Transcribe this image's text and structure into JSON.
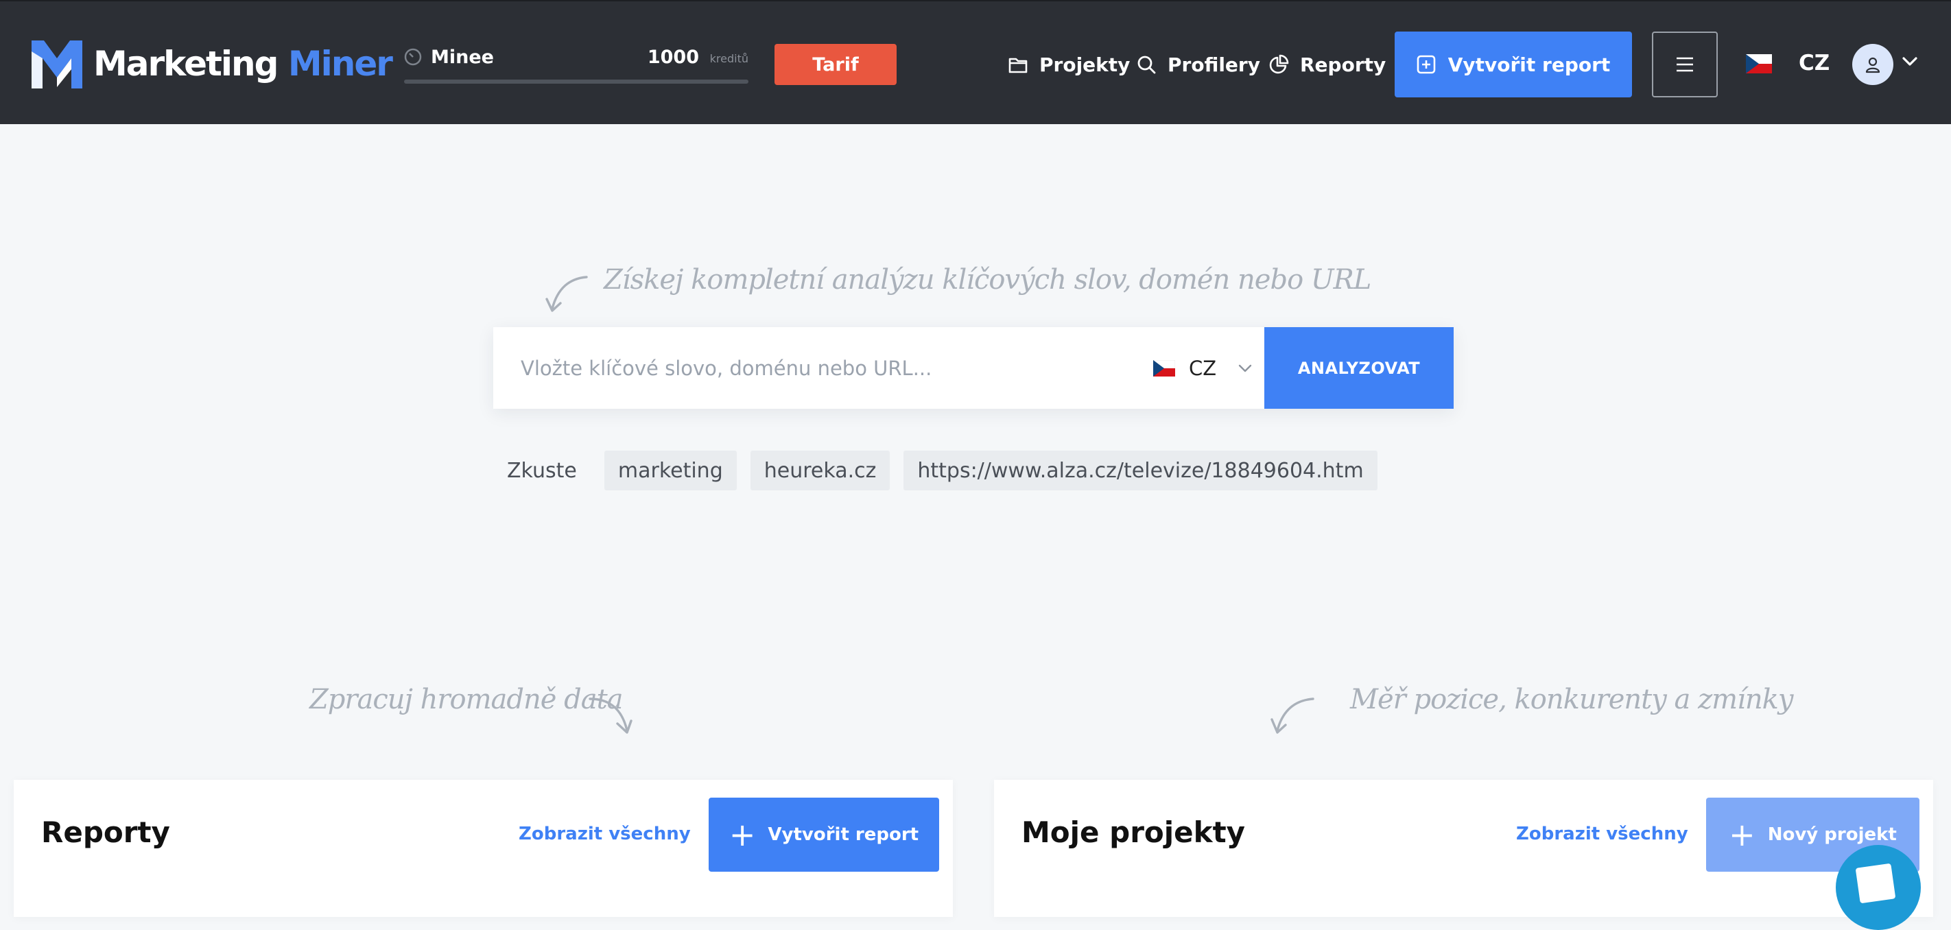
{
  "header": {
    "logo_text": "Marketing",
    "logo_accent": "Miner",
    "credits": {
      "user": "Minee",
      "count": "1000",
      "unit": "kreditů"
    },
    "tarif_label": "Tarif",
    "nav": [
      {
        "label": "Projekty",
        "icon": "folder-icon"
      },
      {
        "label": "Profilery",
        "icon": "search-icon"
      },
      {
        "label": "Reporty",
        "icon": "pie-chart-icon"
      }
    ],
    "create_report_label": "Vytvořit report",
    "language": "CZ"
  },
  "hero": {
    "hint": "Získej kompletní analýzu klíčových slov, domén nebo URL",
    "search_placeholder": "Vložte klíčové slovo, doménu nebo URL...",
    "country": "CZ",
    "analyze_label": "ANALYZOVAT",
    "try_label": "Zkuste",
    "suggestions": [
      "marketing",
      "heureka.cz",
      "https://www.alza.cz/televize/18849604.htm"
    ]
  },
  "hints": {
    "left": "Zpracuj hromadně data",
    "right": "Měř pozice, konkurenty a zmínky"
  },
  "cards": {
    "reports": {
      "title": "Reporty",
      "link": "Zobrazit všechny",
      "button": "Vytvořit report"
    },
    "projects": {
      "title": "Moje projekty",
      "link": "Zobrazit všechny",
      "button": "Nový projekt"
    }
  },
  "colors": {
    "header_bg": "#2c2f35",
    "accent": "#3f81f5",
    "tarif": "#e9573f",
    "page_bg": "#f5f7f9"
  }
}
